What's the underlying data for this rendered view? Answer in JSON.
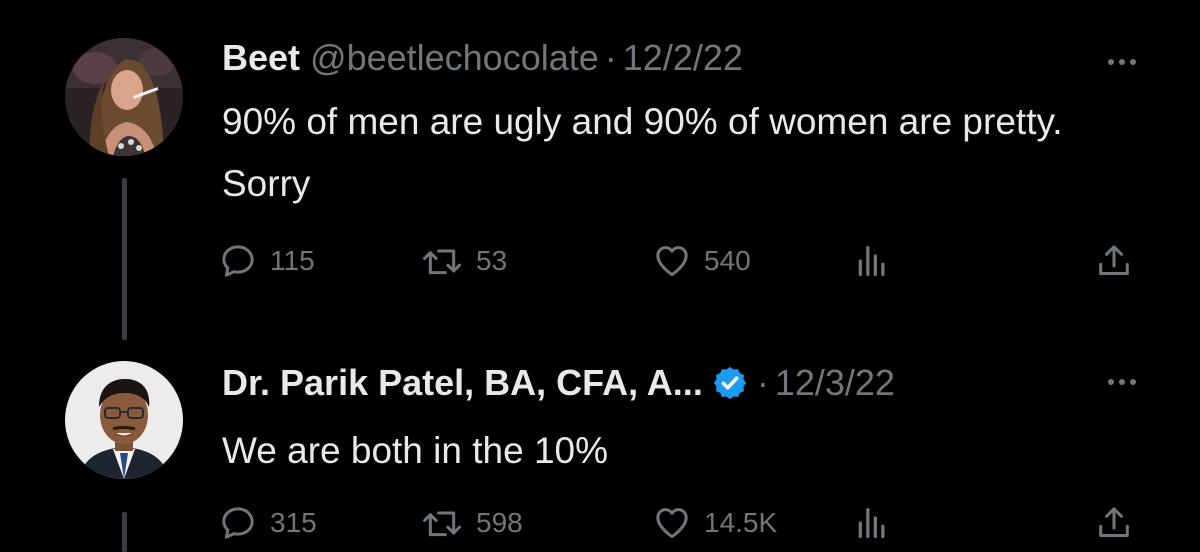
{
  "tweets": [
    {
      "name": "Beet",
      "handle": "@beetlechocolate",
      "separator": "·",
      "date": "12/2/22",
      "text": "90% of men are ugly and 90% of women are pretty. Sorry",
      "verified": false,
      "stats": {
        "replies": "115",
        "retweets": "53",
        "likes": "540"
      }
    },
    {
      "name": "Dr. Parik Patel, BA, CFA, A...",
      "handle": "",
      "separator": "·",
      "date": "12/3/22",
      "text": "We are both in the 10%",
      "verified": true,
      "stats": {
        "replies": "315",
        "retweets": "598",
        "likes": "14.5K"
      }
    }
  ],
  "colors": {
    "background": "#000000",
    "primary_text": "#e7e9ea",
    "secondary_text": "#71767b",
    "verified_blue": "#1d9bf0",
    "thread_line": "#3a3d40"
  },
  "icons": {
    "reply": "speech-bubble-icon",
    "retweet": "retweet-arrows-icon",
    "like": "heart-icon",
    "views": "bar-chart-icon",
    "share": "share-upload-icon",
    "more": "ellipsis-icon",
    "verified": "verified-badge-icon"
  }
}
